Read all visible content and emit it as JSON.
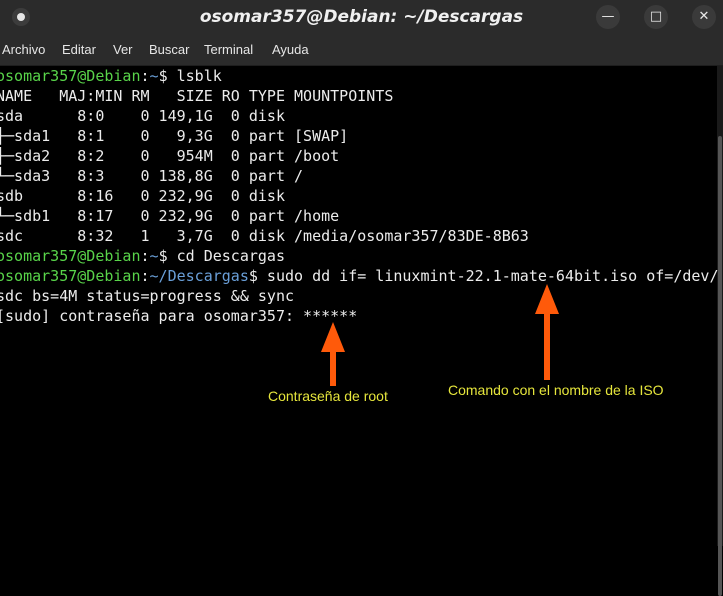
{
  "window": {
    "title": "osomar357@Debian: ~/Descargas",
    "minimize_icon": "minimize-icon",
    "maximize_icon": "maximize-icon",
    "close_icon": "close-icon"
  },
  "menu": [
    "Archivo",
    "Editar",
    "Ver",
    "Buscar",
    "Terminal",
    "Ayuda"
  ],
  "terminal": {
    "l1_user": "osomar357@Debian",
    "l1_sep": ":",
    "l1_path": "~",
    "l1_cmd": "$ lsblk",
    "header": "NAME   MAJ:MIN RM   SIZE RO TYPE MOUNTPOINTS",
    "rows": [
      "sda      8:0    0 149,1G  0 disk",
      "├─sda1   8:1    0   9,3G  0 part [SWAP]",
      "├─sda2   8:2    0   954M  0 part /boot",
      "└─sda3   8:3    0 138,8G  0 part /",
      "sdb      8:16   0 232,9G  0 disk",
      "└─sdb1   8:17   0 232,9G  0 part /home",
      "sdc      8:32   1   3,7G  0 disk /media/osomar357/83DE-8B63"
    ],
    "l2_user": "osomar357@Debian",
    "l2_sep": ":",
    "l2_path": "~",
    "l2_cmd": "$ cd Descargas",
    "l3_user": "osomar357@Debian",
    "l3_sep": ":",
    "l3_path": "~/Descargas",
    "l3_cmd": "$ sudo dd if= linuxmint-22.1-mate-64bit.iso of=/dev/",
    "l4": "sdc bs=4M status=progress && sync",
    "l5": "[sudo] contraseña para osomar357: ******"
  },
  "annotations": {
    "password": "Contraseña de root",
    "command": "Comando con el nombre de la ISO",
    "arrow_color": "#ff5a0a",
    "text_color": "#e6e63c"
  },
  "colors": {
    "prompt_user": "#59d44a",
    "prompt_path": "#6a9fd8",
    "text": "#ececec",
    "titlebar": "#2b2b2b"
  }
}
